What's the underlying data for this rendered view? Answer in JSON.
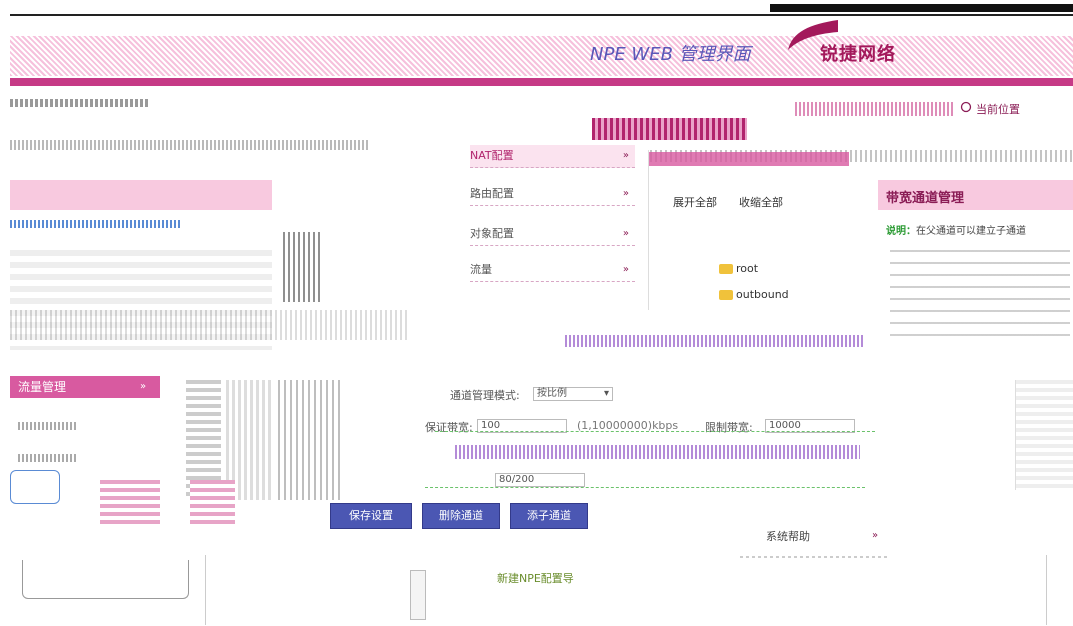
{
  "header": {
    "brand_title": "NPE WEB 管理界面",
    "logo_text": "锐捷网络"
  },
  "breadcrumb": {
    "location_label": "当前位置"
  },
  "nav_menu": {
    "items": [
      {
        "label": "NAT配置"
      },
      {
        "label": "路由配置"
      },
      {
        "label": "对象配置"
      },
      {
        "label": "流量"
      }
    ]
  },
  "tree": {
    "expand_label": "展开全部",
    "collapse_label": "收缩全部",
    "nodes": [
      {
        "label": "root"
      },
      {
        "label": "outbound"
      }
    ]
  },
  "sidebar": {
    "active_item": "流量管理",
    "active_chev": "»"
  },
  "right_panel": {
    "title": "带宽通道管理",
    "desc_prefix": "说明：",
    "desc_text": "在父通道可以建立子通道"
  },
  "form": {
    "mode_label": "通道管理模式:",
    "mode_value": "按比例",
    "guarantee_label": "保证带宽:",
    "guarantee_value": "100",
    "guarantee_unit": "(1,10000000)kbps",
    "max_label": "限制带宽:",
    "max_value": "10000",
    "range_value": "80/200"
  },
  "buttons": {
    "save": "保存设置",
    "delete": "删除通道",
    "add_child": "添子通道"
  },
  "help": {
    "label": "系统帮助",
    "chev": "»"
  },
  "wizard": {
    "label": "新建NPE配置导"
  },
  "colors": {
    "accent": "#c63a86",
    "brand_blue": "#5a57b8",
    "button": "#4b57b3"
  }
}
